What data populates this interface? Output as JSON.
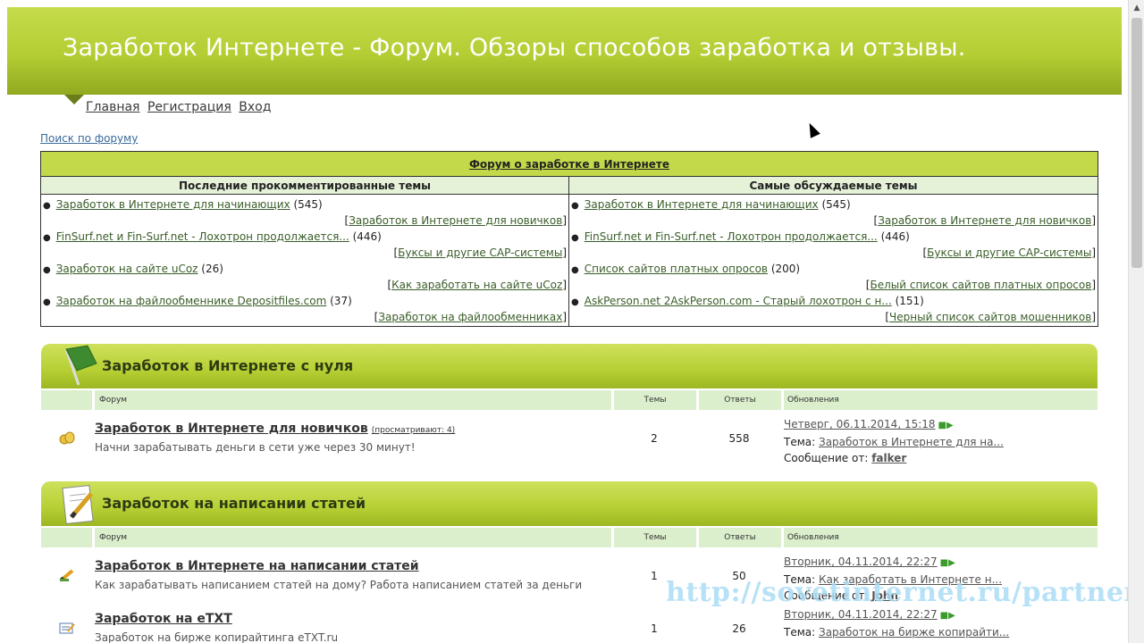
{
  "header": {
    "title": "Заработок Интернете - Форум. Обзоры способов заработка и отзывы."
  },
  "nav": {
    "home": "Главная",
    "register": "Регистрация",
    "login": "Вход"
  },
  "search_link": "Поиск по форуму",
  "summary": {
    "title": "Форум о заработке в Интернете",
    "left_header": "Последние прокомментированные темы",
    "right_header": "Самые обсуждаемые темы",
    "left_items": [
      {
        "title": "Заработок в Интернете для начинающих",
        "count": "(545)",
        "forum": "Заработок в Интернете для новичков"
      },
      {
        "title": "FinSurf.net и Fin-Surf.net - Лохотрон продолжается...",
        "count": "(446)",
        "forum": "Буксы и другие CAP-системы"
      },
      {
        "title": "Заработок на сайте uCoz",
        "count": "(26)",
        "forum": "Как заработать на сайте uCoz"
      },
      {
        "title": "Заработок на файлообменнике Depositfiles.com",
        "count": "(37)",
        "forum": "Заработок на файлообменниках"
      }
    ],
    "right_items": [
      {
        "title": "Заработок в Интернете для начинающих",
        "count": "(545)",
        "forum": "Заработок в Интернете для новичков"
      },
      {
        "title": "FinSurf.net и Fin-Surf.net - Лохотрон продолжается...",
        "count": "(446)",
        "forum": "Буксы и другие CAP-системы"
      },
      {
        "title": "Список сайтов платных опросов",
        "count": "(200)",
        "forum": "Белый список сайтов платных опросов"
      },
      {
        "title": "AskPerson.net 2AskPerson.com - Старый лохотрон с н...",
        "count": "(151)",
        "forum": "Черный список сайтов мошенников"
      }
    ]
  },
  "table_header": {
    "forum": "Форум",
    "topics": "Темы",
    "replies": "Ответы",
    "updates": "Обновления"
  },
  "categories": [
    {
      "title": "Заработок в Интернете с нуля",
      "forums": [
        {
          "name": "Заработок в Интернете для новичков",
          "viewing": "(просматривают: 4)",
          "desc": "Начни зарабатывать деньги в сети уже через 30 минут!",
          "topics": "2",
          "replies": "558",
          "date": "Четверг, 06.11.2014, 15:18",
          "topic_label": "Тема:",
          "topic": "Заработок в Интернете для на...",
          "msg_label": "Сообщение от:",
          "user": "falker"
        }
      ]
    },
    {
      "title": "Заработок на написании статей",
      "forums": [
        {
          "name": "Заработок в Интернете на написании статей",
          "viewing": "",
          "desc": "Как зарабатывать написанием статей на дому? Работа написанием статей за деньги",
          "topics": "1",
          "replies": "50",
          "date": "Вторник, 04.11.2014, 22:27",
          "topic_label": "Тема:",
          "topic": "Как заработать в Интернете н...",
          "msg_label": "Сообщение от:",
          "user": "John"
        },
        {
          "name": "Заработок на eTXT",
          "viewing": "",
          "desc": "Заработок на бирже копирайтинга eTXT.ru",
          "topics": "1",
          "replies": "26",
          "date": "Вторник, 04.11.2014, 22:27",
          "topic_label": "Тема:",
          "topic": "Заработок на бирже копирайти...",
          "msg_label": "",
          "user": ""
        }
      ]
    }
  ],
  "watermark": "http://sovetinternet.ru/partner",
  "colors": {
    "header_green": "#b3cd33",
    "light_green": "#dcefcc",
    "link_green": "#3b5e2a"
  }
}
